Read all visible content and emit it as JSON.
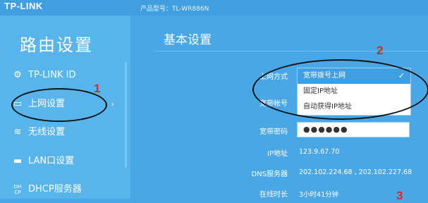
{
  "header": {
    "brand": "TP-LINK",
    "model": "产品型号：TL-WR886N"
  },
  "sidebar": {
    "title": "路由设置",
    "items": [
      {
        "icon": "gear-icon",
        "glyph": "⚙",
        "label": "TP-LINK ID"
      },
      {
        "icon": "monitor-icon",
        "glyph": "▭",
        "label": "上网设置",
        "chevron": "›"
      },
      {
        "icon": "wifi-icon",
        "glyph": "≋",
        "label": "无线设置"
      },
      {
        "icon": "lan-icon",
        "glyph": "▬",
        "label": "LAN口设置"
      },
      {
        "icon": "dhcp-icon",
        "glyph": "DH\nCP",
        "label": "DHCP服务器"
      }
    ]
  },
  "main": {
    "title": "基本设置",
    "fields": {
      "wan_mode_label": "上网方式",
      "account_label": "宽带帐号",
      "password_label": "宽带密码",
      "password_value": "●●●●●●",
      "ip_label": "IP地址",
      "ip_value": "123.9.67.70",
      "dns_label": "DNS服务器",
      "dns_value": "202.102.224.68 , 202.102.227.68",
      "uptime_label": "在线时长",
      "uptime_value": "3小时41分钟"
    },
    "dropdown": {
      "options": [
        "宽带拨号上网",
        "固定IP地址",
        "自动获得IP地址"
      ],
      "selected": "宽带拨号上网",
      "check": "✓"
    }
  },
  "annotations": {
    "one": "1",
    "two": "2",
    "three": "3",
    "color": "#e0251e"
  }
}
